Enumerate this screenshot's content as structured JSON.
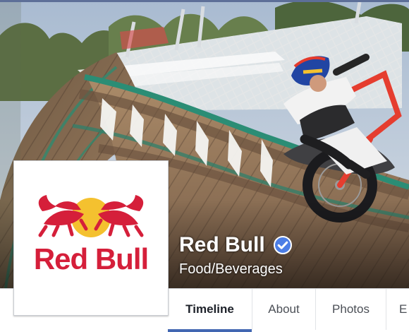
{
  "page": {
    "name": "Red Bull",
    "category": "Food/Beverages",
    "verified": true
  },
  "logo": {
    "wordmark": "Red Bull",
    "colors": {
      "red": "#d51f3a",
      "gold": "#f4c12f",
      "navy": "#001f5f"
    }
  },
  "tabs": [
    {
      "label": "Timeline",
      "active": true
    },
    {
      "label": "About",
      "active": false
    },
    {
      "label": "Photos",
      "active": false
    },
    {
      "label": "E",
      "active": false
    }
  ],
  "colors": {
    "facebook_blue": "#4267b2",
    "verified_blue": "#4c7ee6",
    "page_background": "#e9ebee"
  },
  "icons": {
    "verified": "verified-check-icon"
  }
}
